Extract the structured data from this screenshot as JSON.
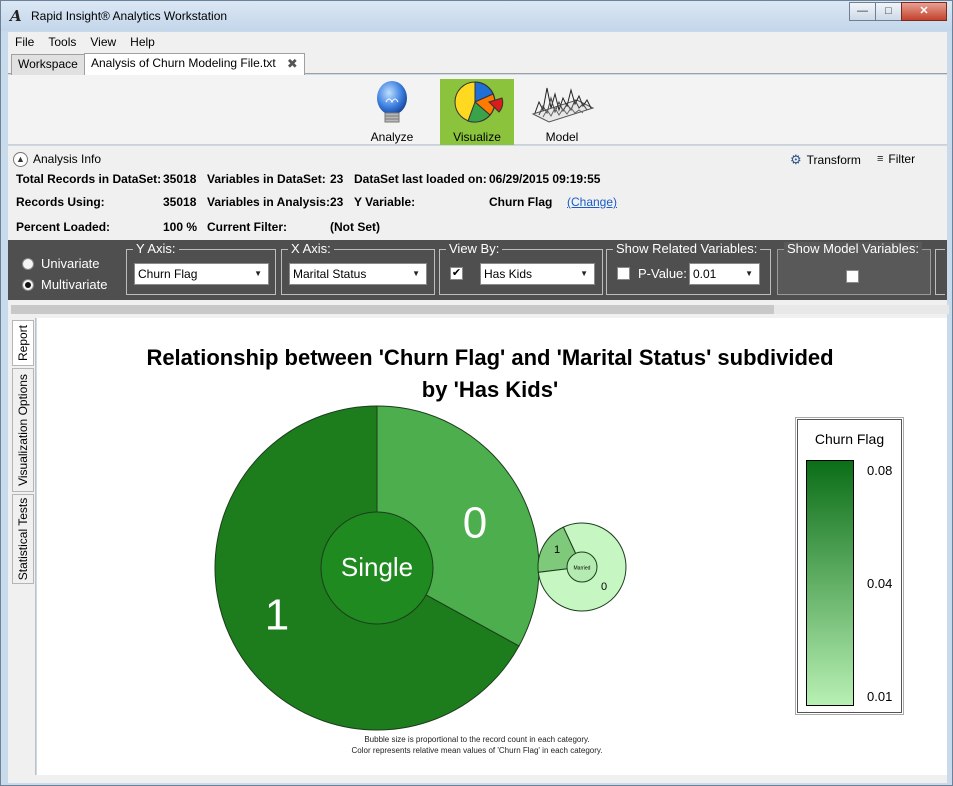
{
  "window": {
    "title": "Rapid Insight® Analytics Workstation",
    "buttons": [
      "—",
      "□",
      "✕"
    ]
  },
  "menu": [
    "File",
    "Tools",
    "View",
    "Help"
  ],
  "tabs": [
    {
      "label": "Workspace"
    },
    {
      "label": "Analysis of Churn Modeling File.txt",
      "close": "✖"
    }
  ],
  "toolbar": {
    "analyze": "Analyze",
    "visualize": "Visualize",
    "model": "Model"
  },
  "info": {
    "header": "Analysis Info",
    "transform": "Transform",
    "filter": "Filter",
    "total_records_label": "Total Records in DataSet:",
    "total_records": "35018",
    "vars_dataset_label": "Variables in DataSet:",
    "vars_dataset": "23",
    "last_loaded_label": "DataSet last loaded on:",
    "last_loaded": "06/29/2015 09:19:55",
    "records_using_label": "Records Using:",
    "records_using": "35018",
    "vars_analysis_label": "Variables in Analysis:",
    "vars_analysis": "23",
    "y_variable_label": "Y Variable:",
    "y_variable": "Churn Flag",
    "change_link": "(Change)",
    "percent_loaded_label": "Percent Loaded:",
    "percent_loaded": "100 %",
    "current_filter_label": "Current Filter:",
    "current_filter": "(Not Set)"
  },
  "controls": {
    "univariate": "Univariate",
    "multivariate": "Multivariate",
    "y_axis_title": "Y Axis:",
    "y_axis_value": "Churn Flag",
    "x_axis_title": "X Axis:",
    "x_axis_value": "Marital Status",
    "view_by_title": "View By:",
    "view_by_value": "Has Kids",
    "view_by_check": "✔",
    "related_title": "Show Related Variables:",
    "p_value_label": "P-Value:",
    "p_value": "0.01",
    "model_vars_title": "Show Model Variables:"
  },
  "sidetabs": [
    "Report",
    "Visualization Options",
    "Statistical Tests"
  ],
  "chart": {
    "title_line1": "Relationship between 'Churn Flag' and 'Marital Status' subdivided",
    "title_line2": "by 'Has Kids'",
    "footnote_line1": "Bubble size is proportional to the record count in each category.",
    "footnote_line2": "Color represents relative mean values of 'Churn Flag' in each category.",
    "legend_title": "Churn Flag",
    "legend_ticks": [
      "0.08",
      "0.04",
      "0.01"
    ]
  },
  "chart_data": {
    "type": "bubble",
    "title": "Relationship between 'Churn Flag' and 'Marital Status' subdivided by 'Has Kids'",
    "color_scale": {
      "label": "Churn Flag",
      "min": 0.01,
      "max": 0.08,
      "low_color": "#b8f0b4",
      "high_color": "#0b6e17"
    },
    "bubbles": [
      {
        "category": "Single",
        "center_color": "#1f8a1f",
        "segments": [
          {
            "label": "0",
            "fraction": 0.33,
            "color": "#4cae4c"
          },
          {
            "label": "1",
            "fraction": 0.67,
            "color": "#1d7d1d"
          }
        ]
      },
      {
        "category": "Married",
        "center_color": "#b3ebb0",
        "segments": [
          {
            "label": "1",
            "fraction": 0.2,
            "color": "#7fc97a"
          },
          {
            "label": "0",
            "fraction": 0.8,
            "color": "#c6f7c3"
          }
        ]
      }
    ]
  }
}
